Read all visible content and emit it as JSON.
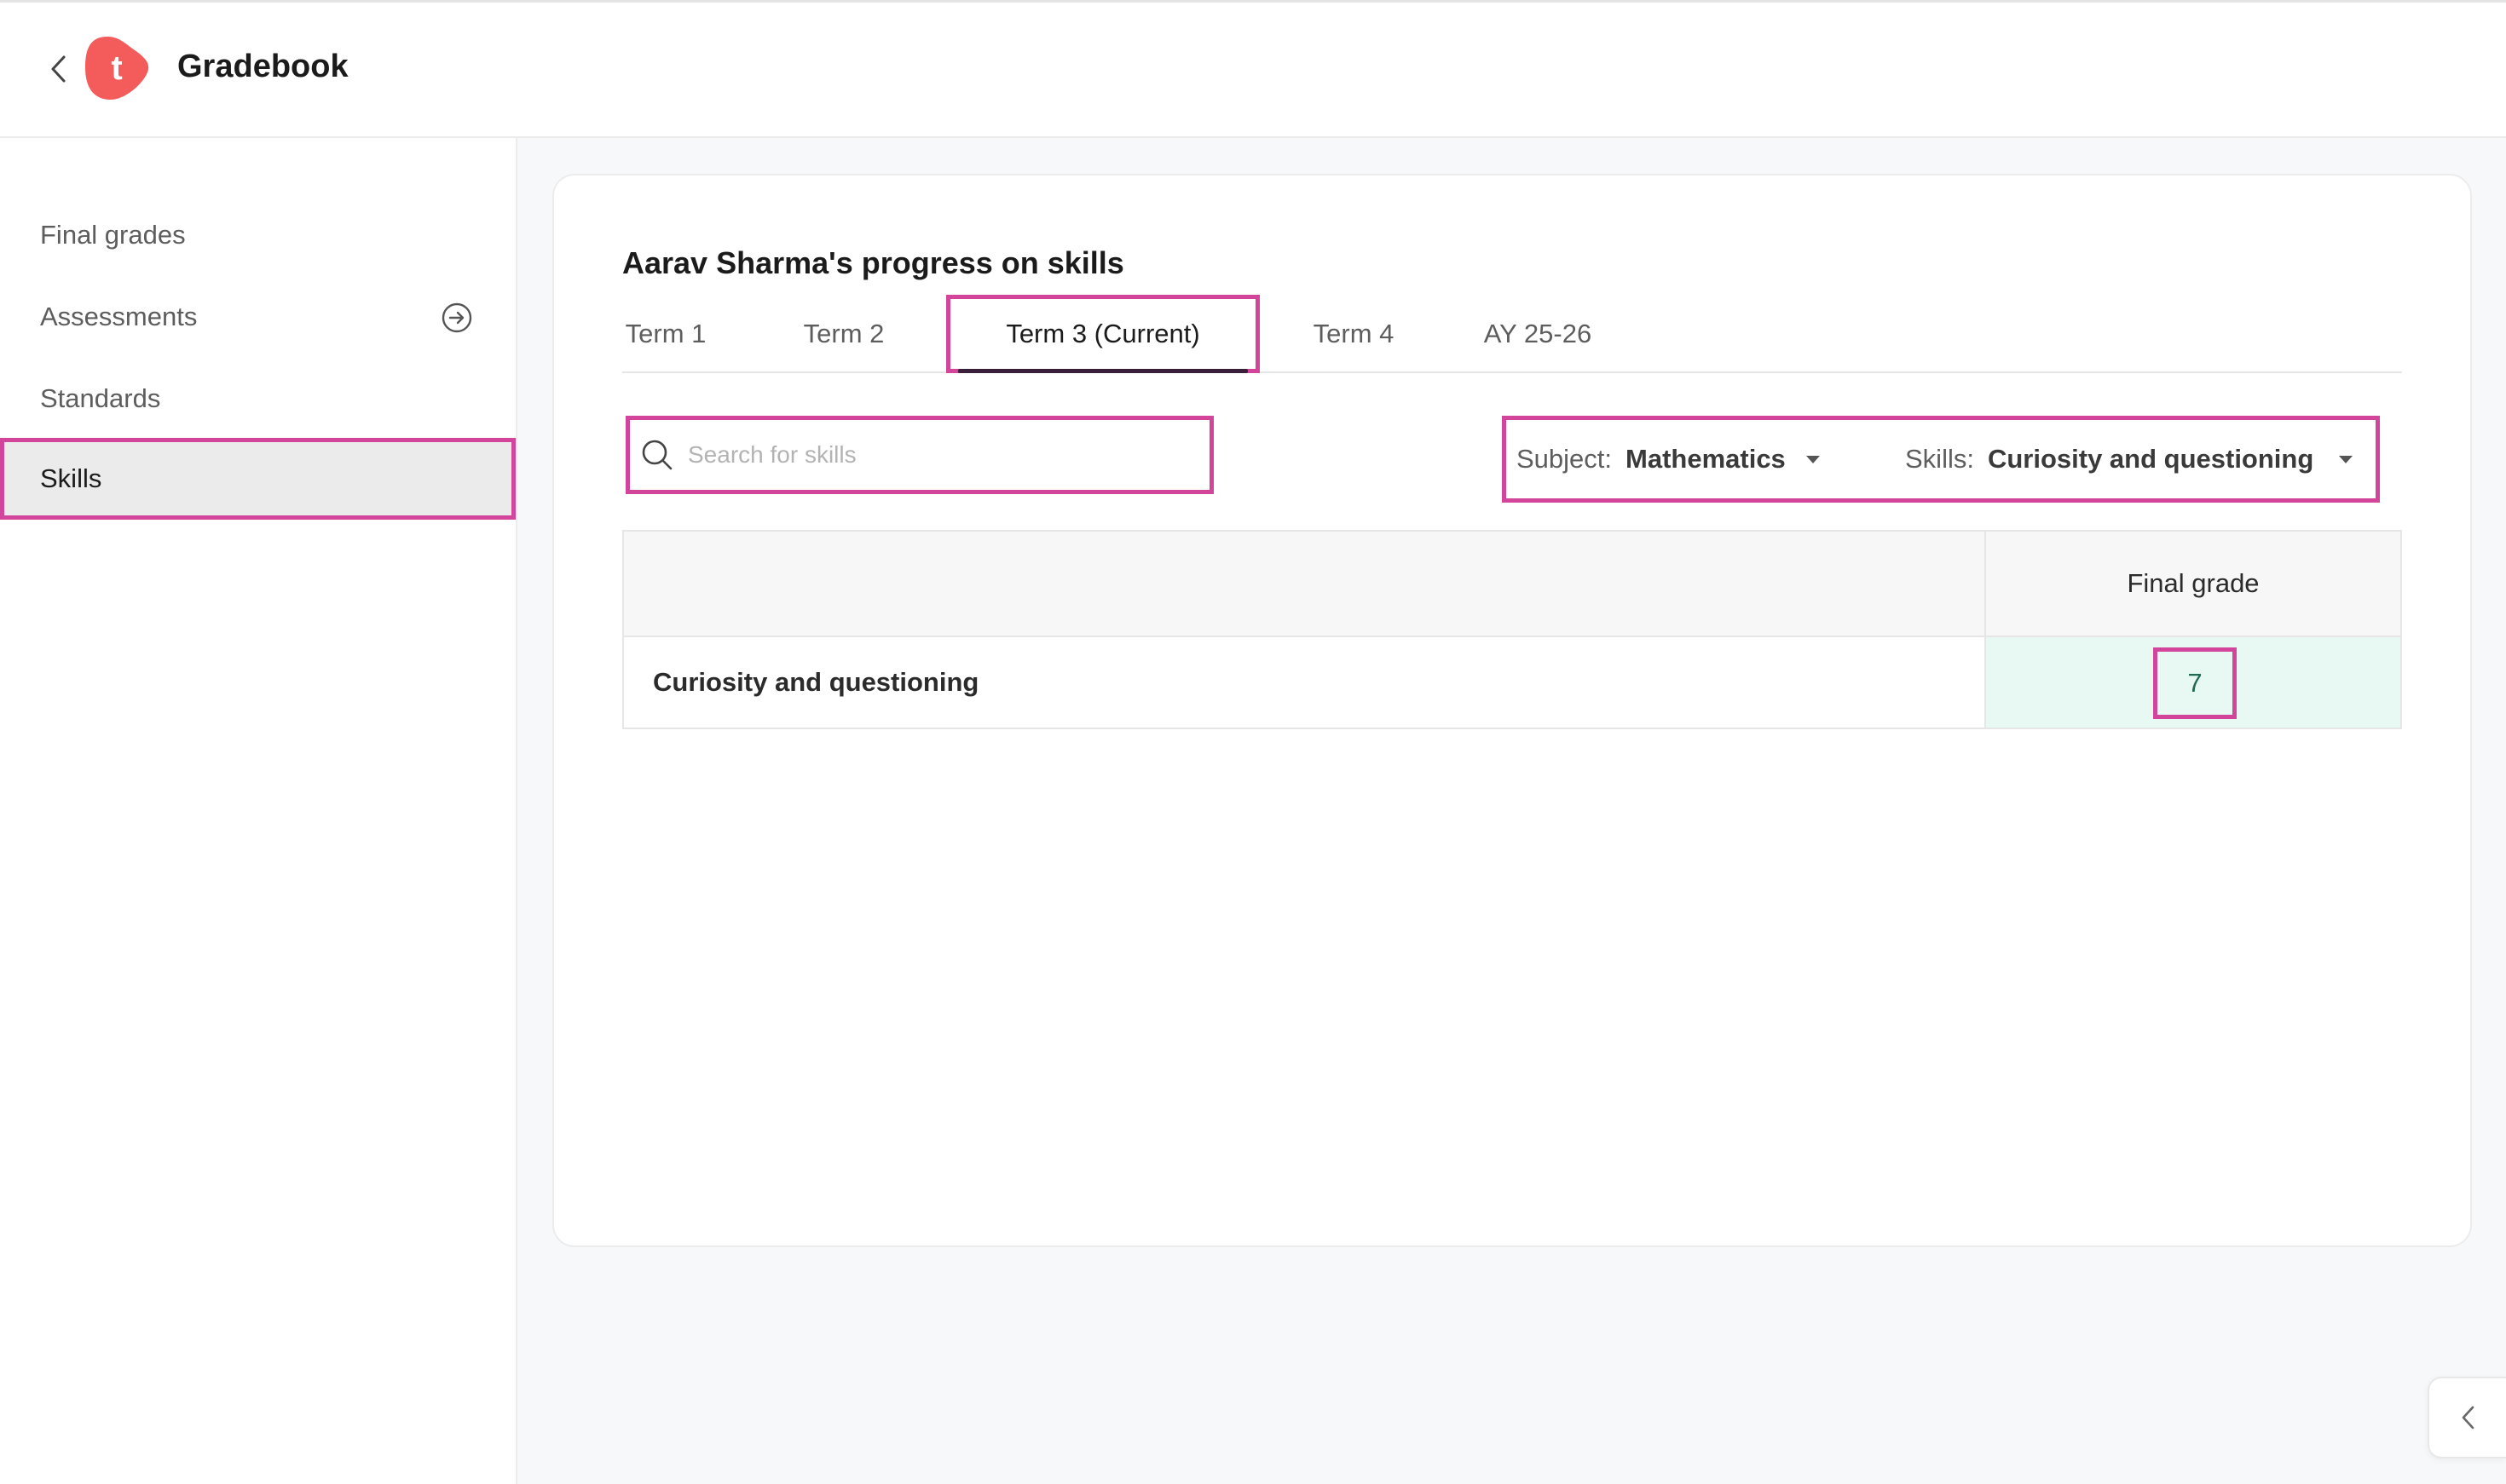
{
  "header": {
    "app_title": "Gradebook",
    "logo_letter": "t",
    "brand_color": "#f45b5b"
  },
  "sidebar": {
    "items": [
      {
        "label": "Final grades"
      },
      {
        "label": "Assessments",
        "icon": "arrow-right-circle-icon"
      },
      {
        "label": "Standards"
      },
      {
        "label": "Skills",
        "active": true
      }
    ]
  },
  "main": {
    "title": "Aarav Sharma's progress on skills",
    "tabs": [
      {
        "label": "Term 1"
      },
      {
        "label": "Term 2"
      },
      {
        "label": "Term 3 (Current)",
        "active": true
      },
      {
        "label": "Term 4"
      },
      {
        "label": "AY 25-26"
      }
    ],
    "search": {
      "placeholder": "Search for skills",
      "value": ""
    },
    "filters": {
      "subject_label": "Subject:",
      "subject_value": "Mathematics",
      "skills_label": "Skills:",
      "skills_value": "Curiosity and questioning"
    },
    "table": {
      "columns": [
        "",
        "Final grade"
      ],
      "rows": [
        {
          "skill": "Curiosity and questioning",
          "final_grade": "7"
        }
      ]
    }
  },
  "colors": {
    "highlight": "#d2459a",
    "grade_cell_bg": "#e8f8f2",
    "active_tab_underline": "#3a1f3a"
  }
}
